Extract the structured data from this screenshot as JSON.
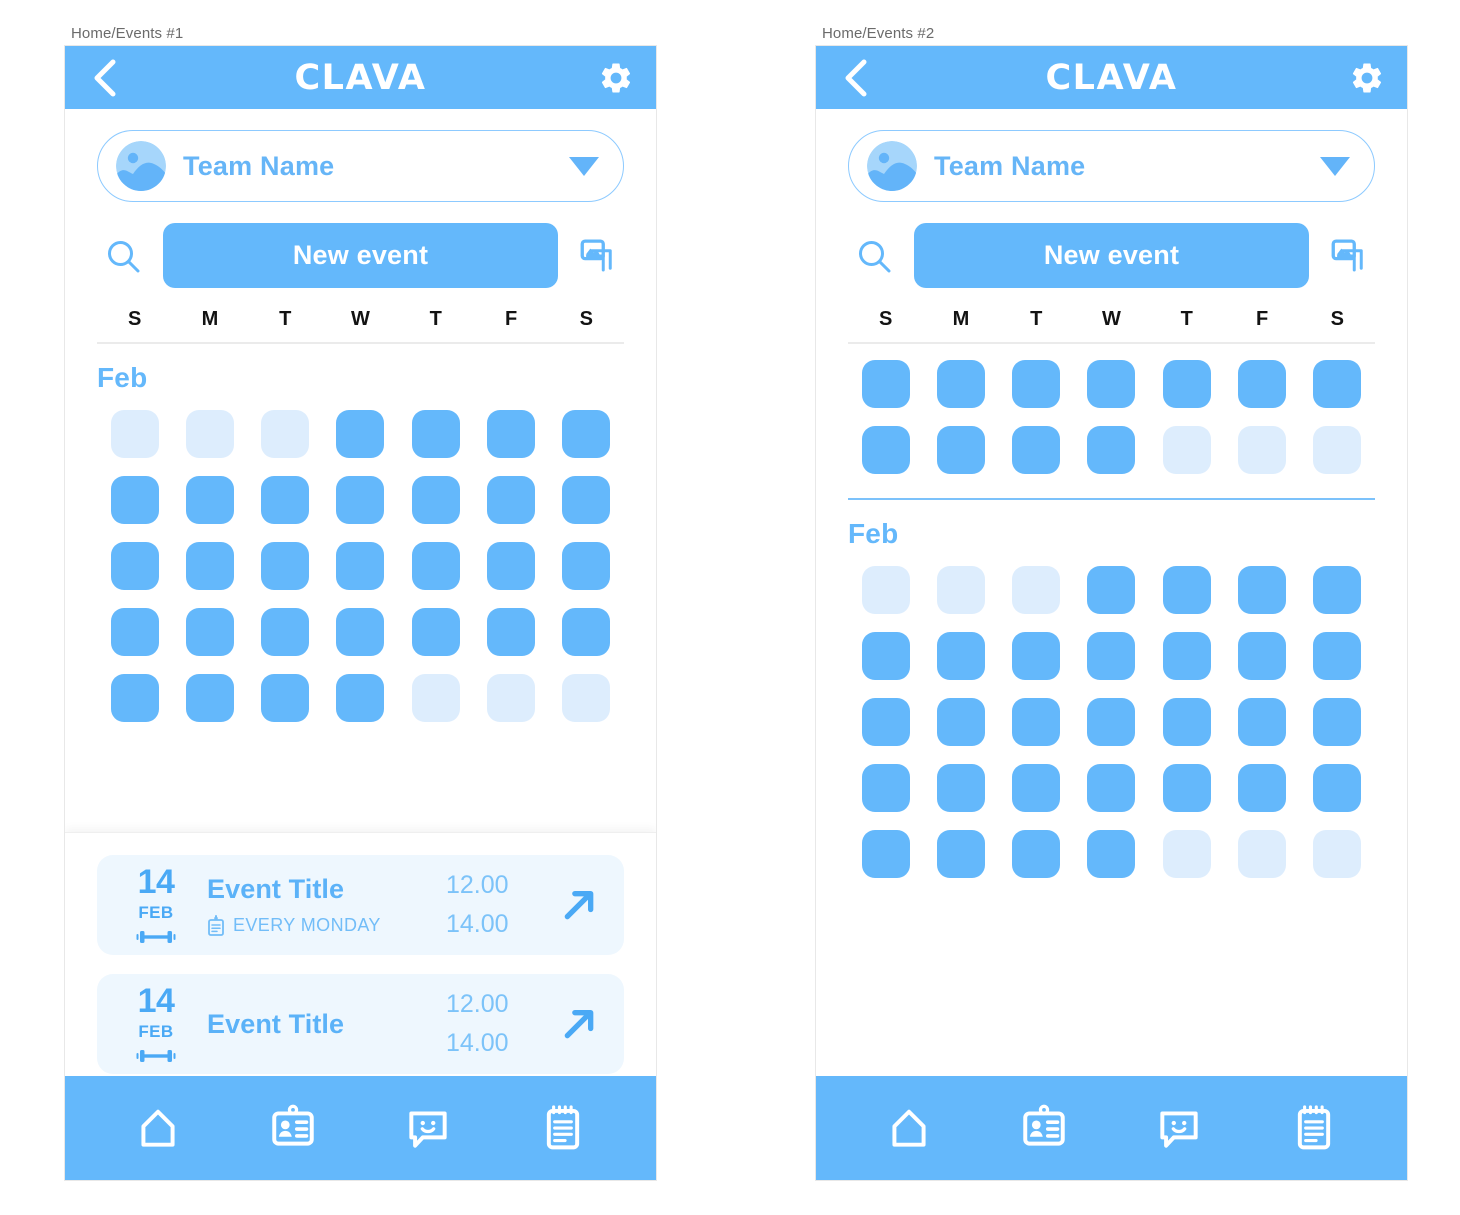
{
  "page": {
    "background": "#ffffff",
    "accent": "#64b8fb",
    "accent_light": "#ddedfd",
    "card_bg": "#eef7fe",
    "text_blue": "#5bb2f8"
  },
  "screens": [
    {
      "caption": "Home/Events #1",
      "appbar": {
        "back_icon": "chevron-left-icon",
        "brand": "CLAVA",
        "settings_icon": "gear-icon"
      },
      "team_selector": {
        "avatar_icon": "team-avatar-image-icon",
        "label": "Team Name",
        "caret_icon": "chevron-down-icon"
      },
      "actions": {
        "search_icon": "search-icon",
        "new_event_label": "New event",
        "gallery_icon": "gallery-stack-icon"
      },
      "weekdays": [
        "S",
        "M",
        "T",
        "W",
        "T",
        "F",
        "S"
      ],
      "pre_month_grid": [],
      "pre_month_divider": false,
      "month": "Feb",
      "month_grid": [
        [
          "faded",
          "faded",
          "faded",
          "solid",
          "solid",
          "solid",
          "solid"
        ],
        [
          "solid",
          "solid",
          "solid",
          "solid",
          "solid",
          "solid",
          "solid"
        ],
        [
          "solid",
          "solid",
          "solid",
          "solid",
          "solid",
          "solid",
          "solid"
        ],
        [
          "solid",
          "solid",
          "solid",
          "solid",
          "solid",
          "solid",
          "solid"
        ],
        [
          "solid",
          "solid",
          "solid",
          "solid",
          "faded",
          "faded",
          "faded"
        ]
      ],
      "has_event_list": true,
      "events": [
        {
          "day": "14",
          "month": "FEB",
          "type_icon": "dumbbell-icon",
          "title": "Event Title",
          "repeat_icon": "clipboard-icon",
          "repeat_text": "EVERY MONDAY",
          "start_time": "12.00",
          "end_time": "14.00",
          "open_icon": "arrow-up-right-icon"
        },
        {
          "day": "14",
          "month": "FEB",
          "type_icon": "dumbbell-icon",
          "title": "Event Title",
          "repeat_icon": null,
          "repeat_text": null,
          "start_time": "12.00",
          "end_time": "14.00",
          "open_icon": "arrow-up-right-icon"
        }
      ],
      "bottom_nav": [
        {
          "name": "home",
          "icon": "home-icon"
        },
        {
          "name": "contacts",
          "icon": "id-card-icon"
        },
        {
          "name": "chat",
          "icon": "chat-smiley-icon"
        },
        {
          "name": "notes",
          "icon": "notepad-icon"
        }
      ]
    },
    {
      "caption": "Home/Events #2",
      "appbar": {
        "back_icon": "chevron-left-icon",
        "brand": "CLAVA",
        "settings_icon": "gear-icon"
      },
      "team_selector": {
        "avatar_icon": "team-avatar-image-icon",
        "label": "Team Name",
        "caret_icon": "chevron-down-icon"
      },
      "actions": {
        "search_icon": "search-icon",
        "new_event_label": "New event",
        "gallery_icon": "gallery-stack-icon"
      },
      "weekdays": [
        "S",
        "M",
        "T",
        "W",
        "T",
        "F",
        "S"
      ],
      "pre_month_grid": [
        [
          "solid",
          "solid",
          "solid",
          "solid",
          "solid",
          "solid",
          "solid"
        ],
        [
          "solid",
          "solid",
          "solid",
          "solid",
          "faded",
          "faded",
          "faded"
        ]
      ],
      "pre_month_divider": true,
      "month": "Feb",
      "month_grid": [
        [
          "faded",
          "faded",
          "faded",
          "solid",
          "solid",
          "solid",
          "solid"
        ],
        [
          "solid",
          "solid",
          "solid",
          "solid",
          "solid",
          "solid",
          "solid"
        ],
        [
          "solid",
          "solid",
          "solid",
          "solid",
          "solid",
          "solid",
          "solid"
        ],
        [
          "solid",
          "solid",
          "solid",
          "solid",
          "solid",
          "solid",
          "solid"
        ],
        [
          "solid",
          "solid",
          "solid",
          "solid",
          "faded",
          "faded",
          "faded"
        ]
      ],
      "has_event_list": false,
      "events": [],
      "bottom_nav": [
        {
          "name": "home",
          "icon": "home-icon"
        },
        {
          "name": "contacts",
          "icon": "id-card-icon"
        },
        {
          "name": "chat",
          "icon": "chat-smiley-icon"
        },
        {
          "name": "notes",
          "icon": "notepad-icon"
        }
      ]
    }
  ]
}
